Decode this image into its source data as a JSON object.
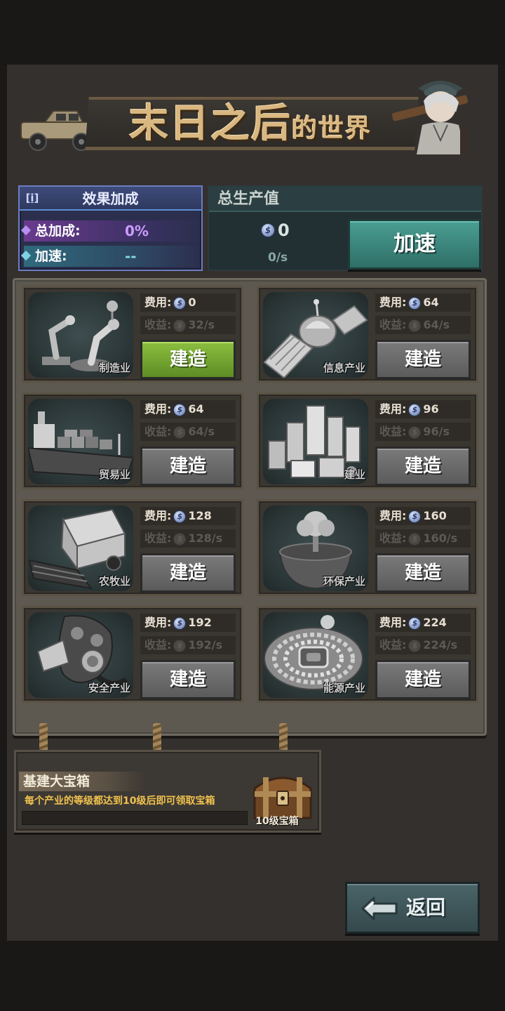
{
  "title": {
    "main": "末日之后",
    "tail": "的世界"
  },
  "effect": {
    "info_label": "[i]",
    "title": "效果加成",
    "rows": [
      {
        "label": "总加成:",
        "value": "0%"
      },
      {
        "label": "加速:",
        "value": "--"
      }
    ]
  },
  "output": {
    "title": "总生产值",
    "value": "0",
    "rate": "0/s",
    "coin_glyph": "$",
    "speed_button": "加速"
  },
  "industries": [
    {
      "name": "制造业",
      "cost_label": "费用:",
      "cost": "0",
      "gain_label": "收益:",
      "gain": "32/s",
      "button": "建造",
      "active": true
    },
    {
      "name": "信息产业",
      "cost_label": "费用:",
      "cost": "64",
      "gain_label": "收益:",
      "gain": "64/s",
      "button": "建造",
      "active": false
    },
    {
      "name": "贸易业",
      "cost_label": "费用:",
      "cost": "64",
      "gain_label": "收益:",
      "gain": "64/s",
      "button": "建造",
      "active": false
    },
    {
      "name": "建业",
      "cost_label": "费用:",
      "cost": "96",
      "gain_label": "收益:",
      "gain": "96/s",
      "button": "建造",
      "active": false
    },
    {
      "name": "农牧业",
      "cost_label": "费用:",
      "cost": "128",
      "gain_label": "收益:",
      "gain": "128/s",
      "button": "建造",
      "active": false
    },
    {
      "name": "环保产业",
      "cost_label": "费用:",
      "cost": "160",
      "gain_label": "收益:",
      "gain": "160/s",
      "button": "建造",
      "active": false
    },
    {
      "name": "安全产业",
      "cost_label": "费用:",
      "cost": "192",
      "gain_label": "收益:",
      "gain": "192/s",
      "button": "建造",
      "active": false
    },
    {
      "name": "能源产业",
      "cost_label": "费用:",
      "cost": "224",
      "gain_label": "收益:",
      "gain": "224/s",
      "button": "建造",
      "active": false
    }
  ],
  "treasure": {
    "title": "基建大宝箱",
    "description": "每个产业的等级都达到10级后即可领取宝箱",
    "chest_label": "10级宝箱",
    "progress": 0
  },
  "back_button": "返回",
  "colors": {
    "accent_green": "#6fa12f",
    "panel_purple": "#2b2f4d",
    "panel_teal": "#223034",
    "gold_text": "#f0c24e"
  }
}
